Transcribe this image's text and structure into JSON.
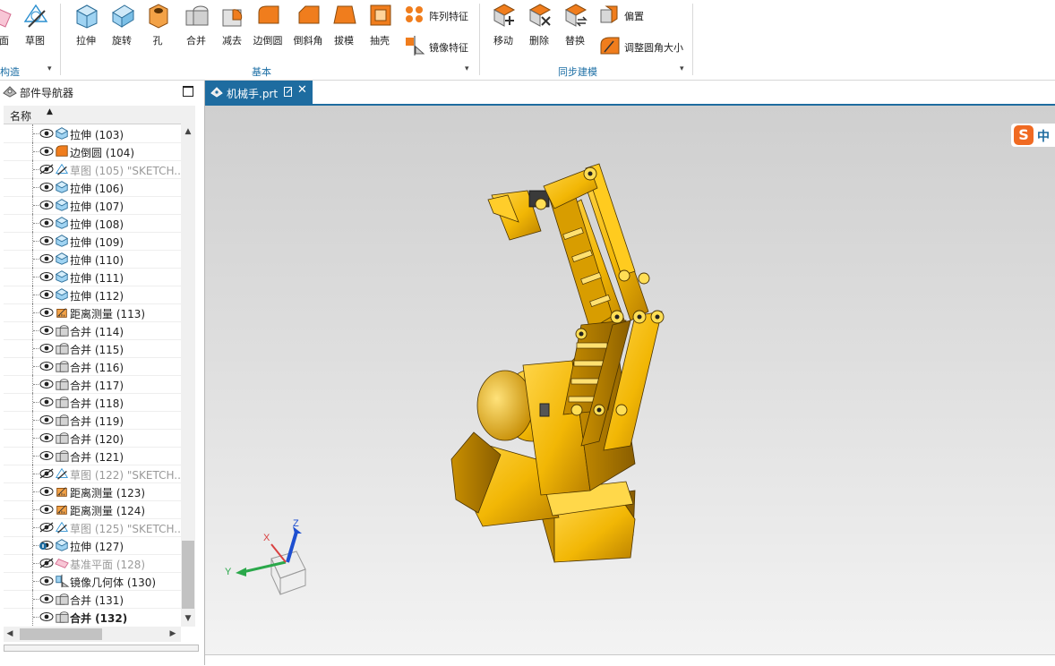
{
  "ribbon": {
    "left_partial": {
      "plane_label": "平面",
      "sketch_label": "草图",
      "group_label": "构造"
    },
    "basic_group": {
      "label": "基本",
      "tools": [
        {
          "label": "拉伸",
          "icon": "extrude-icon"
        },
        {
          "label": "旋转",
          "icon": "revolve-icon"
        },
        {
          "label": "孔",
          "icon": "hole-icon"
        },
        {
          "label": "合并",
          "icon": "unite-icon"
        },
        {
          "label": "减去",
          "icon": "subtract-icon"
        },
        {
          "label": "边倒圆",
          "icon": "edge-blend-icon"
        },
        {
          "label": "倒斜角",
          "icon": "chamfer-icon"
        },
        {
          "label": "拔模",
          "icon": "draft-icon"
        },
        {
          "label": "抽壳",
          "icon": "shell-icon"
        }
      ],
      "side_tools": [
        {
          "label": "阵列特征",
          "icon": "pattern-feature-icon"
        },
        {
          "label": "镜像特征",
          "icon": "mirror-feature-icon"
        }
      ]
    },
    "sync_group": {
      "label": "同步建模",
      "tools": [
        {
          "label": "移动",
          "icon": "move-face-icon"
        },
        {
          "label": "删除",
          "icon": "delete-face-icon"
        },
        {
          "label": "替换",
          "icon": "replace-face-icon"
        }
      ],
      "side_tools": [
        {
          "label": "偏置",
          "icon": "offset-region-icon"
        },
        {
          "label": "调整圆角大小",
          "icon": "resize-blend-icon"
        }
      ]
    }
  },
  "navigator": {
    "title": "部件导航器",
    "column_header": "名称",
    "items": [
      {
        "label": "拉伸 (103)",
        "type": "extrude",
        "visible": true
      },
      {
        "label": "边倒圆 (104)",
        "type": "blend",
        "visible": true
      },
      {
        "label": "草图 (105) \"SKETCH...",
        "type": "sketch",
        "visible": false
      },
      {
        "label": "拉伸 (106)",
        "type": "extrude",
        "visible": true
      },
      {
        "label": "拉伸 (107)",
        "type": "extrude",
        "visible": true
      },
      {
        "label": "拉伸 (108)",
        "type": "extrude",
        "visible": true
      },
      {
        "label": "拉伸 (109)",
        "type": "extrude",
        "visible": true
      },
      {
        "label": "拉伸 (110)",
        "type": "extrude",
        "visible": true
      },
      {
        "label": "拉伸 (111)",
        "type": "extrude",
        "visible": true
      },
      {
        "label": "拉伸 (112)",
        "type": "extrude",
        "visible": true
      },
      {
        "label": "距离测量 (113)",
        "type": "measure",
        "visible": true
      },
      {
        "label": "合并 (114)",
        "type": "unite",
        "visible": true
      },
      {
        "label": "合并 (115)",
        "type": "unite",
        "visible": true
      },
      {
        "label": "合并 (116)",
        "type": "unite",
        "visible": true
      },
      {
        "label": "合并 (117)",
        "type": "unite",
        "visible": true
      },
      {
        "label": "合并 (118)",
        "type": "unite",
        "visible": true
      },
      {
        "label": "合并 (119)",
        "type": "unite",
        "visible": true
      },
      {
        "label": "合并 (120)",
        "type": "unite",
        "visible": true
      },
      {
        "label": "合并 (121)",
        "type": "unite",
        "visible": true
      },
      {
        "label": "草图 (122) \"SKETCH...",
        "type": "sketch",
        "visible": false
      },
      {
        "label": "距离测量 (123)",
        "type": "measure",
        "visible": true
      },
      {
        "label": "距离测量 (124)",
        "type": "measure",
        "visible": true
      },
      {
        "label": "草图 (125) \"SKETCH...",
        "type": "sketch",
        "visible": false
      },
      {
        "label": "拉伸 (127)",
        "type": "extrude",
        "visible": true,
        "info_badge": true
      },
      {
        "label": "基准平面 (128)",
        "type": "datum",
        "visible": false
      },
      {
        "label": "镜像几何体 (130)",
        "type": "mirror",
        "visible": true
      },
      {
        "label": "合并 (131)",
        "type": "unite",
        "visible": true
      },
      {
        "label": "合并 (132)",
        "type": "unite",
        "visible": true,
        "current": true
      }
    ]
  },
  "tab": {
    "label": "机械手.prt",
    "close": "✕"
  },
  "viewport": {
    "triad": {
      "x": "X",
      "y": "Y",
      "z": "Z"
    },
    "ime_badge": {
      "logo": "S",
      "mode": "中"
    }
  },
  "colors": {
    "accent": "#1e6ca0",
    "model": "#f2b705",
    "extrude_icon": "#4aa3df",
    "orange_icon": "#f07d1d"
  }
}
